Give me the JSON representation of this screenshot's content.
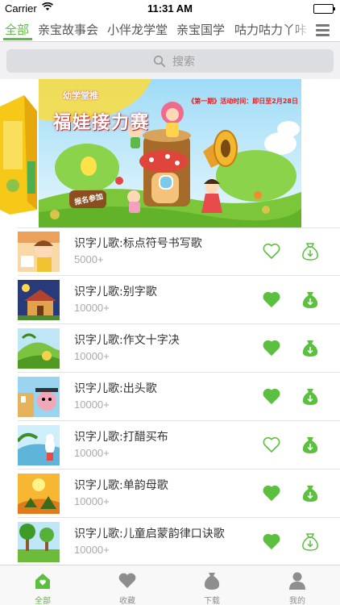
{
  "status_bar": {
    "carrier": "Carrier",
    "time": "11:31 AM"
  },
  "tabs": [
    {
      "label": "全部",
      "active": true
    },
    {
      "label": "亲宝故事会",
      "active": false
    },
    {
      "label": "小伴龙学堂",
      "active": false
    },
    {
      "label": "亲宝国学",
      "active": false
    },
    {
      "label": "咕力咕力丫咔",
      "active": false
    }
  ],
  "search": {
    "placeholder": "搜索"
  },
  "banner": {
    "subtitle": "幼学堂推",
    "title": "福娃接力赛",
    "note": "《第一期》活动时间：即日至2月28日",
    "signup": "报名参加"
  },
  "items": [
    {
      "title": "识字儿歌:标点符号书写歌",
      "count": "5000+",
      "favorited": false,
      "downloaded": false
    },
    {
      "title": "识字儿歌:别字歌",
      "count": "10000+",
      "favorited": true,
      "downloaded": true
    },
    {
      "title": "识字儿歌:作文十字决",
      "count": "10000+",
      "favorited": true,
      "downloaded": true
    },
    {
      "title": "识字儿歌:出头歌",
      "count": "10000+",
      "favorited": true,
      "downloaded": true
    },
    {
      "title": "识字儿歌:打醋买布",
      "count": "10000+",
      "favorited": false,
      "downloaded": true
    },
    {
      "title": "识字儿歌:单韵母歌",
      "count": "10000+",
      "favorited": true,
      "downloaded": true
    },
    {
      "title": "识字儿歌:儿童启蒙韵律口诀歌",
      "count": "10000+",
      "favorited": true,
      "downloaded": false
    }
  ],
  "tab_bar": [
    {
      "label": "全部",
      "icon": "home-icon",
      "active": true
    },
    {
      "label": "收藏",
      "icon": "heart-icon",
      "active": false
    },
    {
      "label": "下载",
      "icon": "download-bag-icon",
      "active": false
    },
    {
      "label": "我的",
      "icon": "person-icon",
      "active": false
    }
  ],
  "colors": {
    "accent": "#5bbf3f",
    "inactive": "#8e8e8e"
  }
}
